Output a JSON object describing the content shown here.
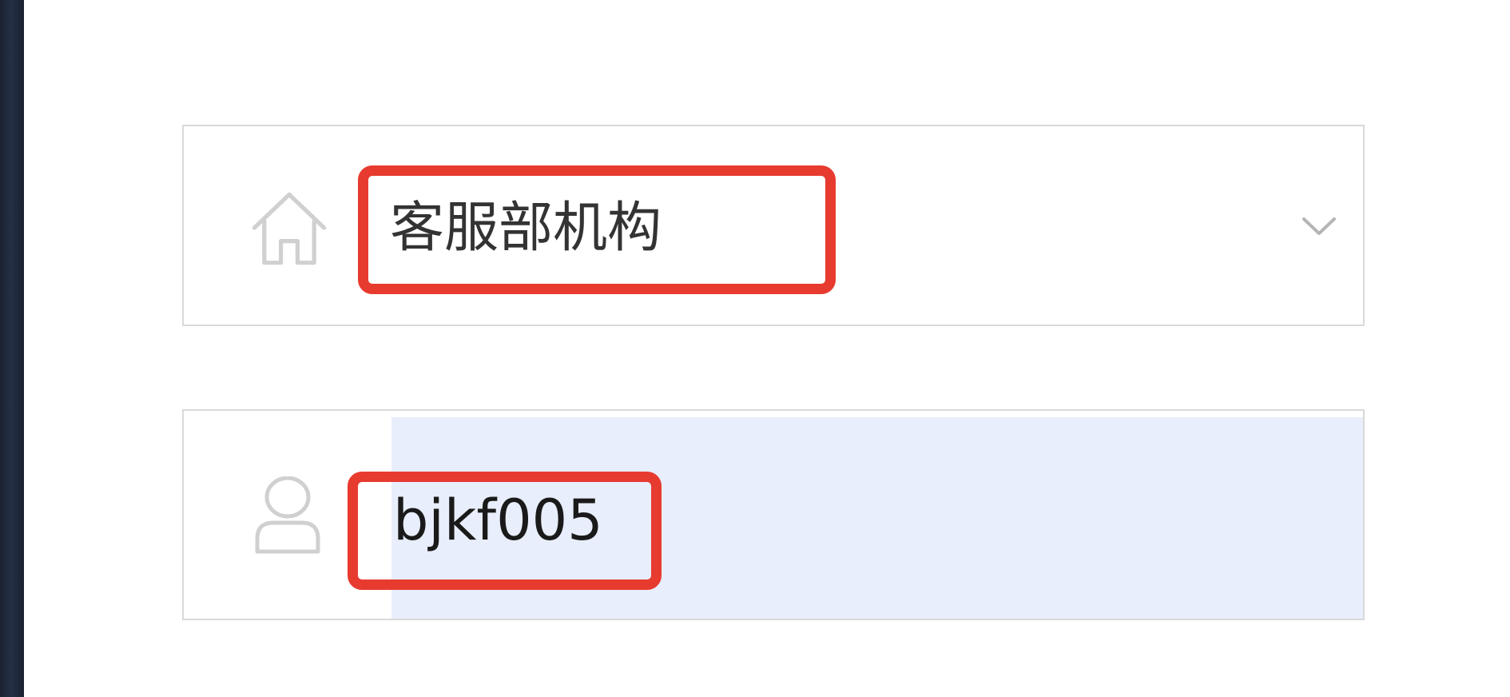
{
  "login_form": {
    "organization_select": {
      "selected_value": "客服部机构",
      "icon": "home-icon",
      "dropdown_icon": "chevron-down-icon"
    },
    "username_input": {
      "value": "bjkf005",
      "icon": "user-icon",
      "autofill_background": "#e8eefb"
    }
  },
  "annotation": {
    "highlight_color": "#e73b2f"
  }
}
